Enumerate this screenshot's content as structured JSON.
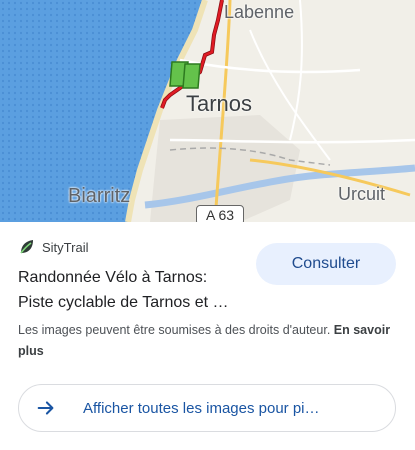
{
  "map": {
    "labels": {
      "labenne": "Labenne",
      "tarnos": "Tarnos",
      "biarritz": "Biarritz",
      "urcuit": "Urcuit"
    },
    "road_shield": "A 63"
  },
  "result": {
    "source_name": "SityTrail",
    "title_line1": "Randonnée Vélo à Tarnos:",
    "title_line2": "Piste cyclable de Tarnos et …",
    "consult_label": "Consulter",
    "disclaimer": "Les images peuvent être soumises à des droits d'auteur.",
    "learn_more": "En savoir plus",
    "all_images_label": "Afficher toutes les images pour pi…"
  },
  "colors": {
    "sea": "#5b9fe0",
    "land": "#f1efe8",
    "route": "#e01b24",
    "accent_button_bg": "#e8f0fe",
    "link_blue": "#1a55a3"
  },
  "icons": {
    "source_logo": "leaf-icon",
    "all_images": "arrow-right-icon",
    "map_marker": "green-flag-icon"
  }
}
